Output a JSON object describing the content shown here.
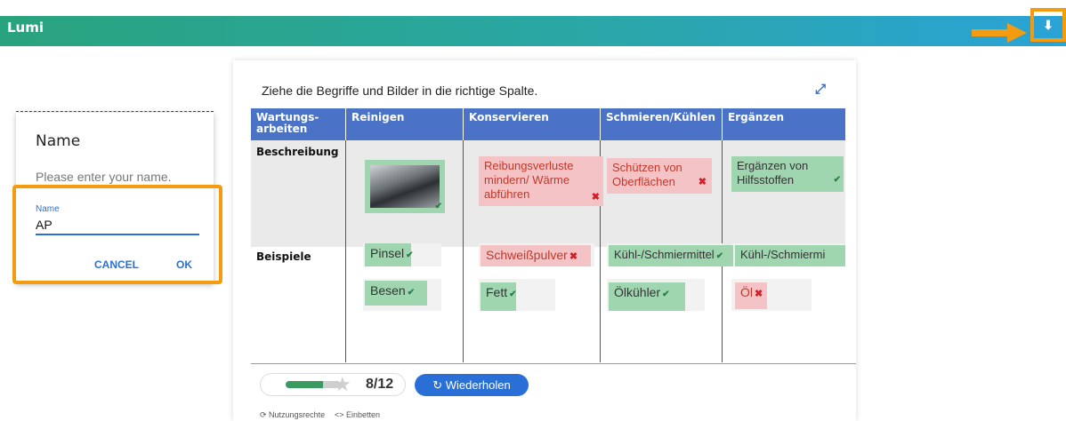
{
  "app": {
    "title": "Lumi"
  },
  "header": {
    "download_icon": "download-icon",
    "download_glyph": "⬇"
  },
  "task": {
    "instruction": "Ziehe die Begriffe und Bilder in die richtige Spalte.",
    "columns": [
      "Wartungs-\narbeiten",
      "Reinigen",
      "Konservieren",
      "Schmieren/Kühlen",
      "Ergänzen"
    ],
    "rows": [
      "Beschreibung",
      "Beispiele"
    ],
    "chips": {
      "konservieren_desc": "Reibungsverluste mindern/ Wärme abführen",
      "schmieren_desc": "Schützen von Oberflächen",
      "ergaenzen_desc": "Ergänzen von Hilfsstoffen",
      "pinsel": "Pinsel",
      "besen": "Besen",
      "schweisspulver": "Schweißpulver",
      "fett": "Fett",
      "kuehl1": "Kühl-/Schmiermittel",
      "kuehl2": "Kühl-/Schmiermi",
      "oelkuehler": "Ölkühler",
      "oel": "Öl"
    },
    "progress_fraction": 0.67,
    "score": "8/12",
    "retry_label": "Wiederholen",
    "rights_label": "Nutzungsrechte",
    "embed_label": "Einbetten"
  },
  "dialog": {
    "title": "Name",
    "prompt": "Please enter your name.",
    "field_label": "Name",
    "field_value": "AP",
    "cancel_label": "CANCEL",
    "ok_label": "OK"
  },
  "colors": {
    "accent": "#2a6fd6",
    "highlight": "#f39c12",
    "correct": "#9fd6b0",
    "wrong": "#f4c3c6",
    "header": "#4a73c8"
  }
}
